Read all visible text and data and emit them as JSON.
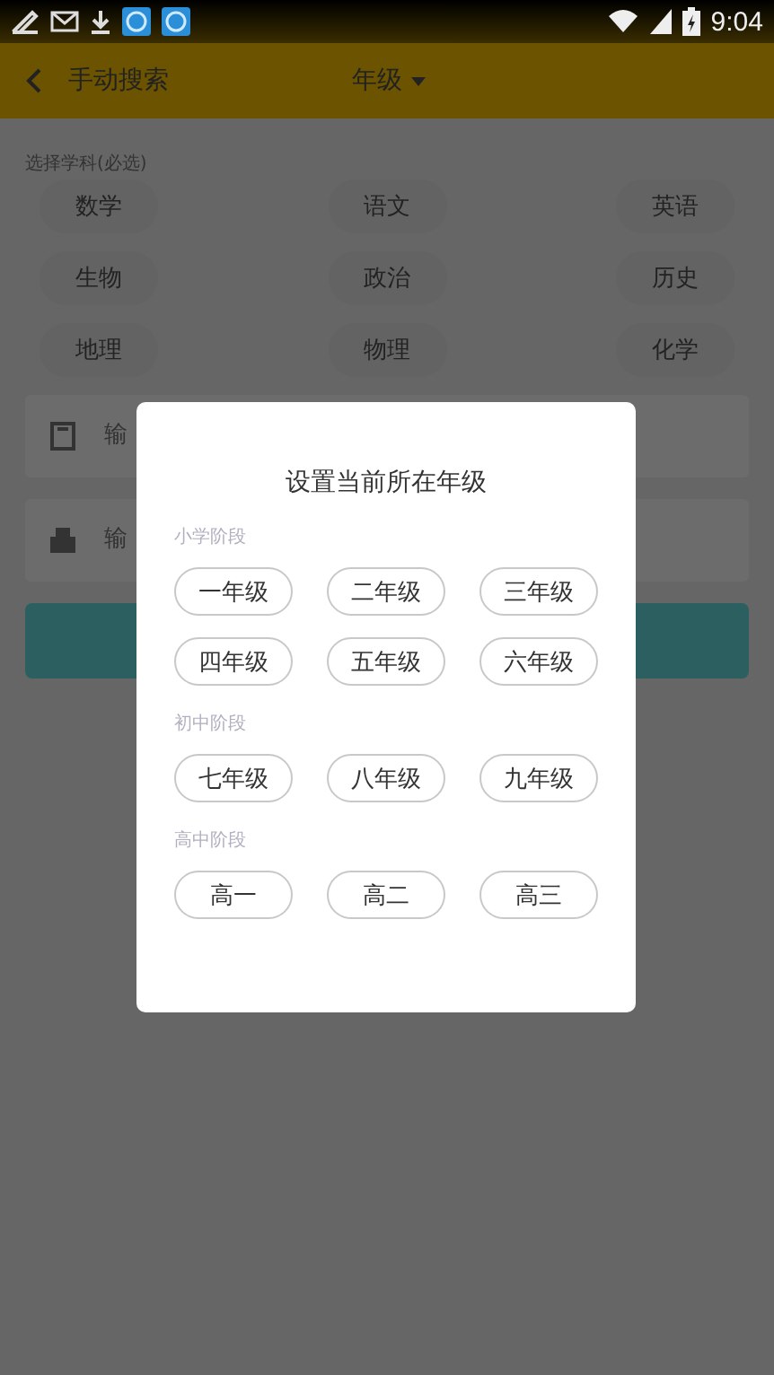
{
  "status_bar": {
    "time": "9:04"
  },
  "header": {
    "back_label": "手动搜索",
    "grade_picker": "年级"
  },
  "subject_section": {
    "label": "选择学科(必选)",
    "subjects": [
      "数学",
      "语文",
      "英语",
      "生物",
      "政治",
      "历史",
      "地理",
      "物理",
      "化学"
    ]
  },
  "fields": [
    {
      "kind": "book",
      "placeholder": "输"
    },
    {
      "kind": "printer",
      "placeholder": "输"
    }
  ],
  "dialog": {
    "title": "设置当前所在年级",
    "stages": [
      {
        "label": "小学阶段",
        "grades": [
          "一年级",
          "二年级",
          "三年级",
          "四年级",
          "五年级",
          "六年级"
        ]
      },
      {
        "label": "初中阶段",
        "grades": [
          "七年级",
          "八年级",
          "九年级"
        ]
      },
      {
        "label": "高中阶段",
        "grades": [
          "高一",
          "高二",
          "高三"
        ]
      }
    ]
  }
}
